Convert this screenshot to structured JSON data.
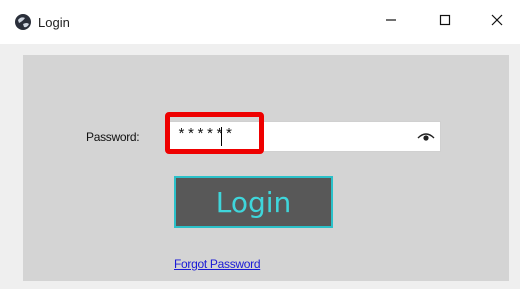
{
  "window": {
    "title": "Login",
    "icon": "app-globe-icon",
    "controls": [
      "minimize-icon",
      "maximize-icon",
      "close-icon"
    ]
  },
  "form": {
    "password_label": "Password:",
    "password_value": "******",
    "eye_icon": "eye-icon",
    "login_label": "Login",
    "forgot_label": "Forgot Password"
  },
  "colors": {
    "client_bg": "#d4d4d4",
    "login_button_bg": "#585858",
    "login_accent": "#3fd6db",
    "highlight": "#ee0000",
    "link": "#1a1ad6"
  }
}
